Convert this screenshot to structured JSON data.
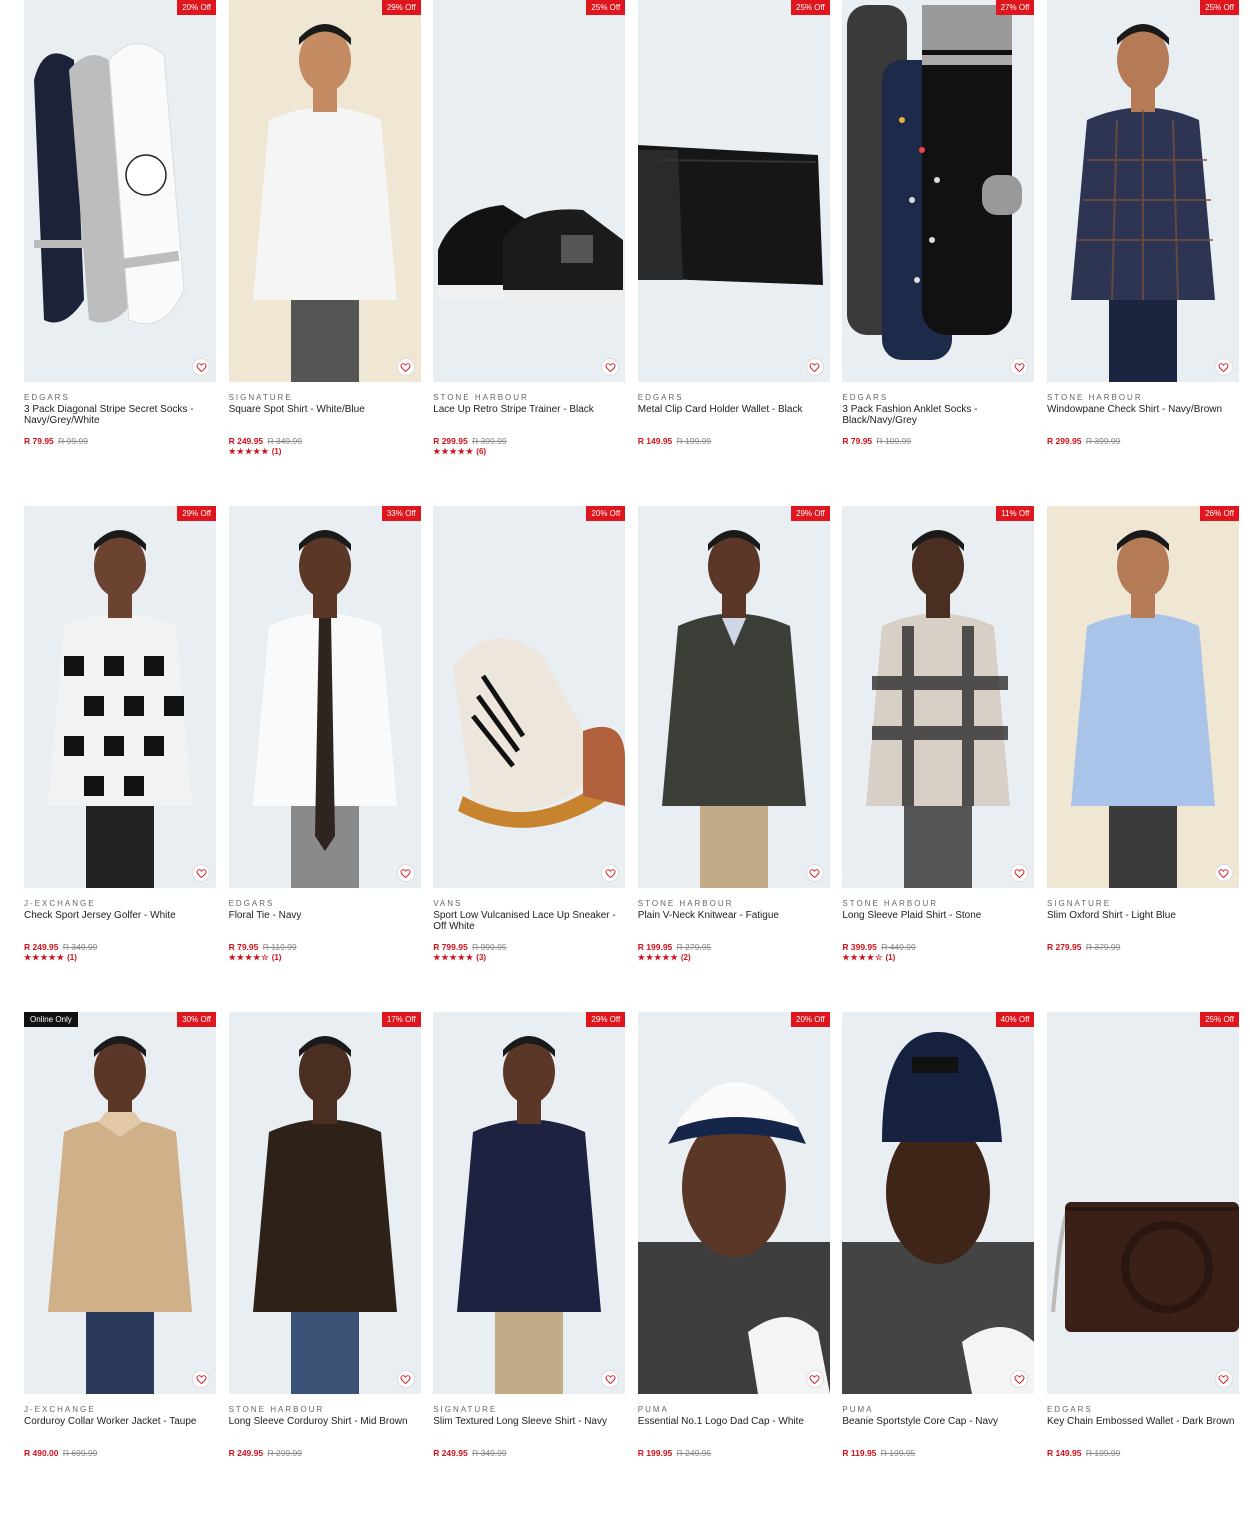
{
  "products": [
    {
      "brand": "EDGARS",
      "title": "3 Pack Diagonal Stripe Secret Socks - Navy/Grey/White",
      "price": "R 79.95",
      "was": "R 99.99",
      "badge": "20% Off",
      "stars": "",
      "reviews": "",
      "image": "socks-liner"
    },
    {
      "brand": "SIGNATURE",
      "title": "Square Spot Shirt - White/Blue",
      "price": "R 249.95",
      "was": "R 349.99",
      "badge": "29% Off",
      "stars": "★★★★★",
      "reviews": "(1)",
      "image": "model-white-shirt"
    },
    {
      "brand": "STONE HARBOUR",
      "title": "Lace Up Retro Stripe Trainer - Black",
      "price": "R 299.95",
      "was": "R 399.99",
      "badge": "25% Off",
      "stars": "★★★★★",
      "reviews": "(6)",
      "image": "black-trainers"
    },
    {
      "brand": "EDGARS",
      "title": "Metal Clip Card Holder Wallet - Black",
      "price": "R 149.95",
      "was": "R 199.99",
      "badge": "25% Off",
      "stars": "",
      "reviews": "",
      "image": "black-wallet"
    },
    {
      "brand": "EDGARS",
      "title": "3 Pack Fashion Anklet Socks - Black/Navy/Grey",
      "price": "R 79.95",
      "was": "R 109.99",
      "badge": "27% Off",
      "stars": "",
      "reviews": "",
      "image": "dress-socks"
    },
    {
      "brand": "STONE HARBOUR",
      "title": "Windowpane Check Shirt - Navy/Brown",
      "price": "R 299.95",
      "was": "R 399.99",
      "badge": "25% Off",
      "stars": "",
      "reviews": "",
      "image": "model-check-shirt"
    },
    {
      "brand": "J-EXCHANGE",
      "title": "Check Sport Jersey Golfer - White",
      "price": "R 249.95",
      "was": "R 349.99",
      "badge": "29% Off",
      "stars": "★★★★★",
      "reviews": "(1)",
      "image": "model-check-golfer"
    },
    {
      "brand": "EDGARS",
      "title": "Floral Tie - Navy",
      "price": "R 79.95",
      "was": "R 119.99",
      "badge": "33% Off",
      "stars": "★★★★☆",
      "reviews": "(1)",
      "image": "model-floral-tie"
    },
    {
      "brand": "VANS",
      "title": "Sport Low Vulcanised Lace Up Sneaker - Off White",
      "price": "R 799.95",
      "was": "R 999.95",
      "badge": "20% Off",
      "stars": "★★★★★",
      "reviews": "(3)",
      "image": "vans-sneaker"
    },
    {
      "brand": "STONE HARBOUR",
      "title": "Plain V-Neck Knitwear - Fatigue",
      "price": "R 199.95",
      "was": "R 279.95",
      "badge": "29% Off",
      "stars": "★★★★★",
      "reviews": "(2)",
      "image": "model-knitwear"
    },
    {
      "brand": "STONE HARBOUR",
      "title": "Long Sleeve Plaid Shirt - Stone",
      "price": "R 399.95",
      "was": "R 449.99",
      "badge": "11% Off",
      "stars": "★★★★☆",
      "reviews": "(1)",
      "image": "model-plaid-shirt"
    },
    {
      "brand": "SIGNATURE",
      "title": "Slim Oxford Shirt - Light Blue",
      "price": "R 279.95",
      "was": "R 379.99",
      "badge": "26% Off",
      "stars": "",
      "reviews": "",
      "image": "model-oxford-shirt"
    },
    {
      "brand": "J-EXCHANGE",
      "title": "Corduroy Collar Worker Jacket - Taupe",
      "price": "R 490.00",
      "was": "R 699.99",
      "badge": "30% Off",
      "online": "Online Only",
      "stars": "",
      "reviews": "",
      "image": "model-worker-jacket"
    },
    {
      "brand": "STONE HARBOUR",
      "title": "Long Sleeve Corduroy Shirt - Mid Brown",
      "price": "R 249.95",
      "was": "R 299.99",
      "badge": "17% Off",
      "stars": "",
      "reviews": "",
      "image": "model-corduroy-shirt"
    },
    {
      "brand": "SIGNATURE",
      "title": "Slim Textured Long Sleeve Shirt - Navy",
      "price": "R 249.95",
      "was": "R 349.99",
      "badge": "29% Off",
      "stars": "",
      "reviews": "",
      "image": "model-navy-shirt"
    },
    {
      "brand": "PUMA",
      "title": "Essential No.1 Logo Dad Cap - White",
      "price": "R 199.95",
      "was": "R 249.95",
      "badge": "20% Off",
      "stars": "",
      "reviews": "",
      "image": "model-white-cap"
    },
    {
      "brand": "PUMA",
      "title": "Beanie Sportstyle Core Cap - Navy",
      "price": "R 119.95",
      "was": "R 199.95",
      "badge": "40% Off",
      "stars": "",
      "reviews": "",
      "image": "model-navy-beanie"
    },
    {
      "brand": "EDGARS",
      "title": "Key Chain Embossed Wallet - Dark Brown",
      "price": "R 149.95",
      "was": "R 199.99",
      "badge": "25% Off",
      "stars": "",
      "reviews": "",
      "image": "brown-wallet"
    }
  ],
  "icons": {
    "wishlist": "heart-icon"
  },
  "colors": {
    "sale": "#d0121c",
    "badge": "#e0161e"
  }
}
